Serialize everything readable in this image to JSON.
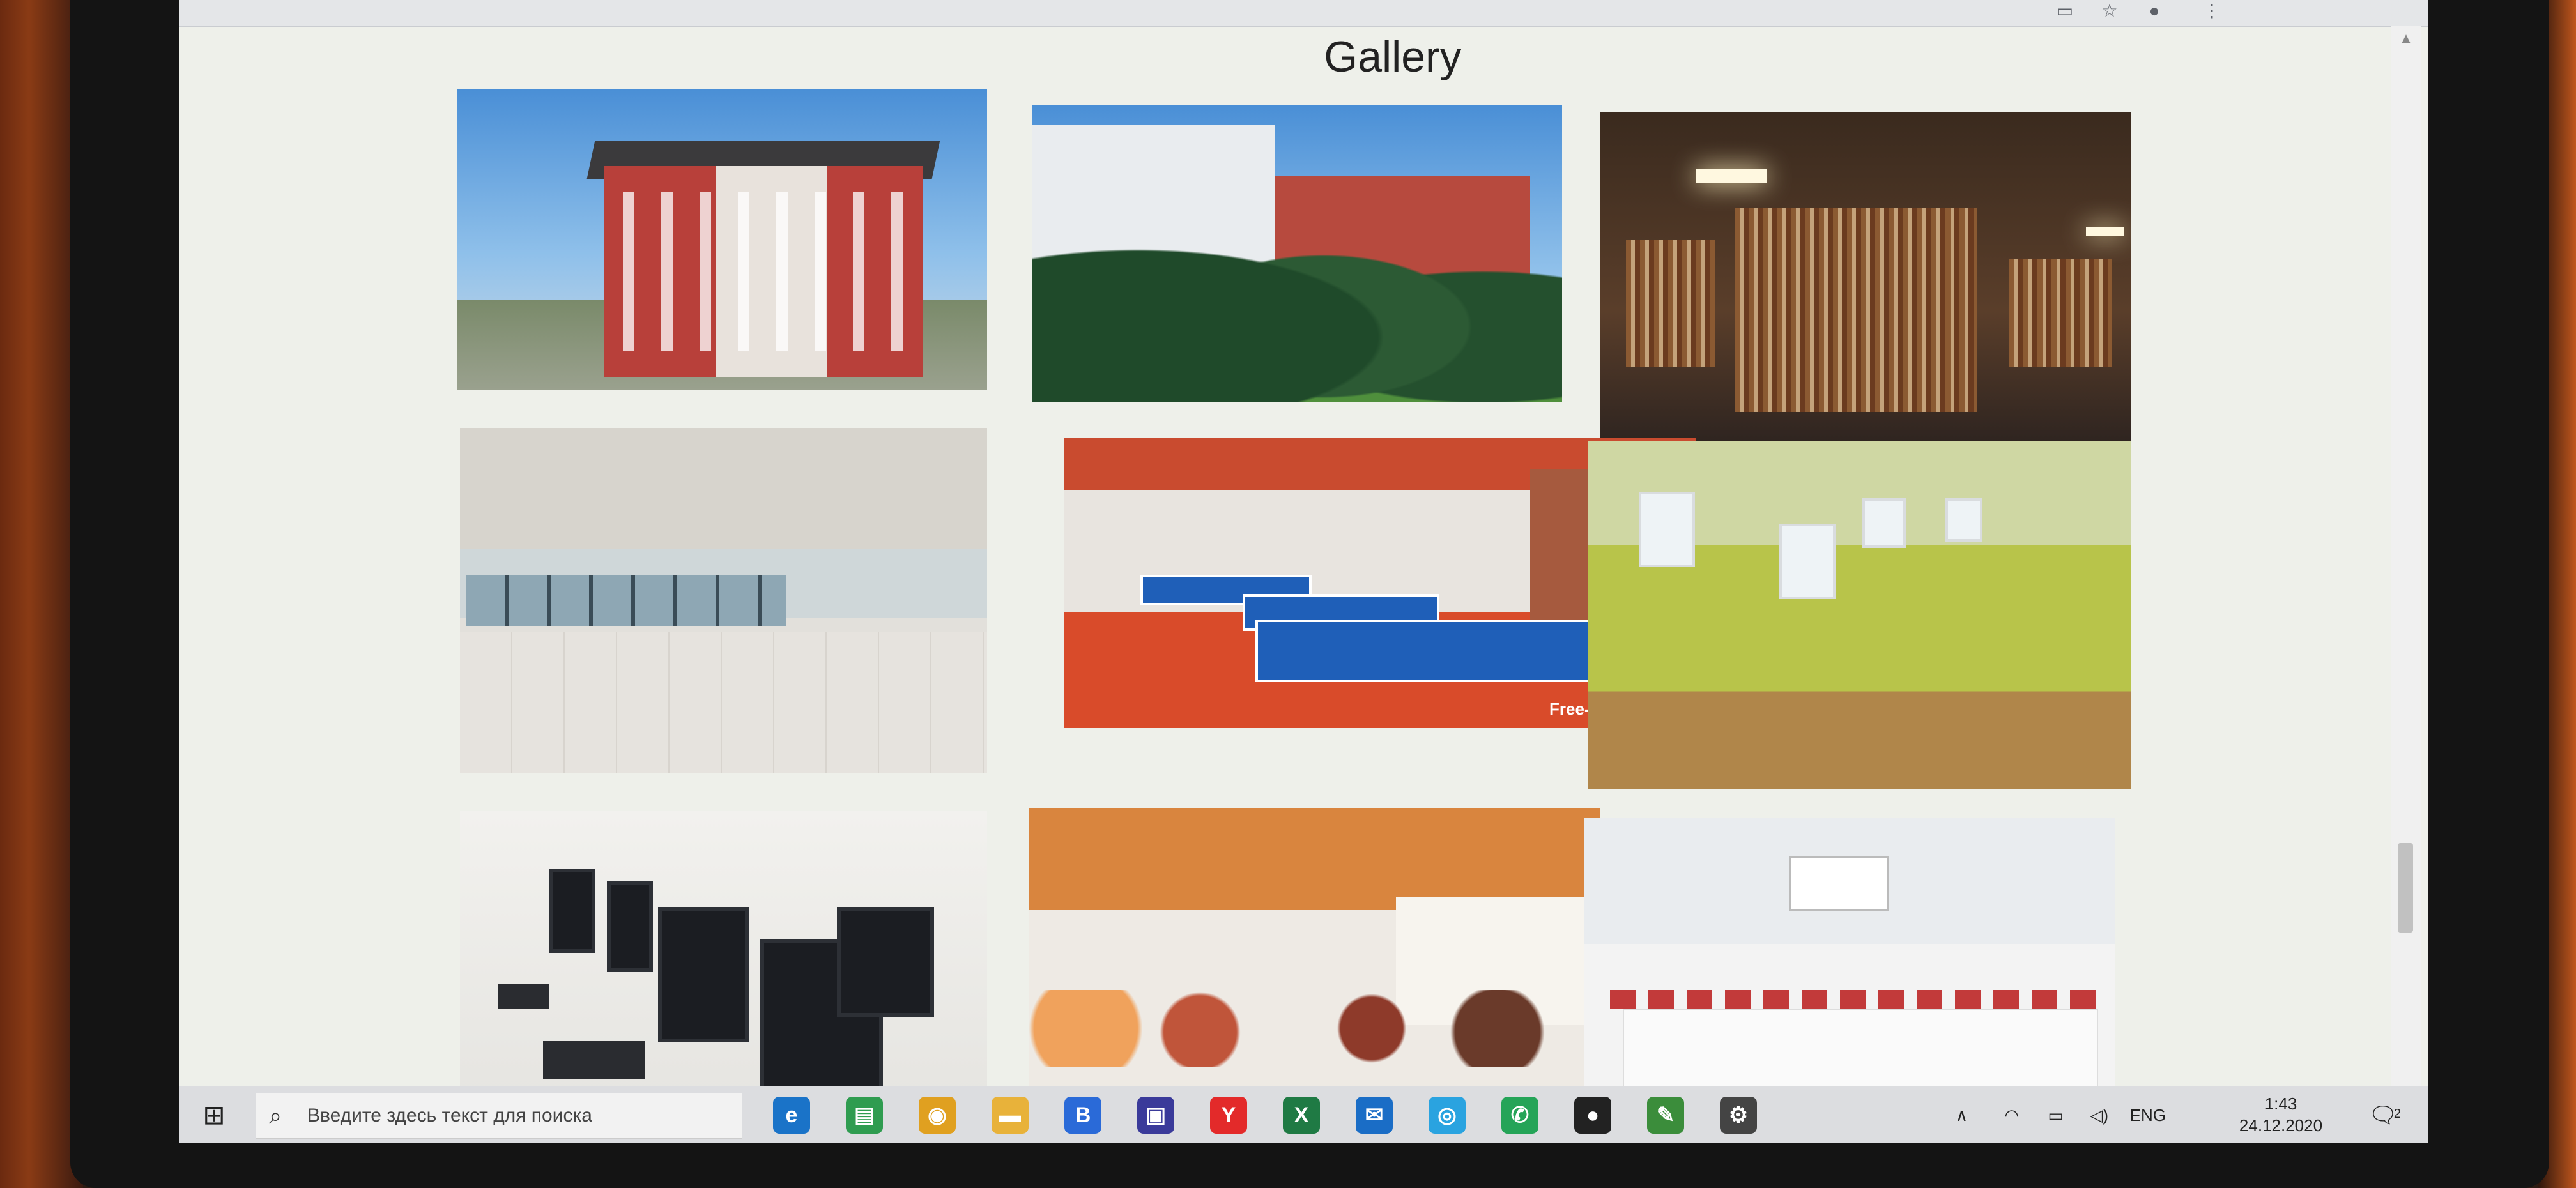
{
  "page": {
    "title": "Gallery"
  },
  "gallery": {
    "tiles": [
      {
        "id": "building"
      },
      {
        "id": "campus"
      },
      {
        "id": "library"
      },
      {
        "id": "hall"
      },
      {
        "id": "pingpong",
        "watermark": "Free-Apply"
      },
      {
        "id": "gym"
      },
      {
        "id": "computers"
      },
      {
        "id": "canteen"
      },
      {
        "id": "conference"
      }
    ]
  },
  "taskbar": {
    "search_placeholder": "Введите здесь текст для поиска",
    "apps": [
      {
        "icon": "edge-icon",
        "color": "#1a73c8"
      },
      {
        "icon": "chat-icon",
        "color": "#2f9c50"
      },
      {
        "icon": "chrome-icon",
        "color": "#e0a020"
      },
      {
        "icon": "folder-icon",
        "color": "#e8b23a"
      },
      {
        "icon": "b-app-icon",
        "label": "B",
        "color": "#2a6ad8"
      },
      {
        "icon": "store-icon",
        "color": "#3a3a9a"
      },
      {
        "icon": "yandex-icon",
        "label": "Y",
        "color": "#e32a2a"
      },
      {
        "icon": "excel-icon",
        "label": "X",
        "color": "#1f7a44"
      },
      {
        "icon": "mail-icon",
        "color": "#1a6dc6"
      },
      {
        "icon": "camera-icon",
        "color": "#2aa3e0"
      },
      {
        "icon": "whatsapp-icon",
        "color": "#25a458"
      },
      {
        "icon": "github-icon",
        "color": "#222222"
      },
      {
        "icon": "paint-icon",
        "color": "#3b8d3b"
      },
      {
        "icon": "settings-icon",
        "color": "#444444"
      }
    ],
    "tray": {
      "language": "ENG",
      "time": "1:43",
      "date": "24.12.2020",
      "notification_count": "2"
    }
  }
}
